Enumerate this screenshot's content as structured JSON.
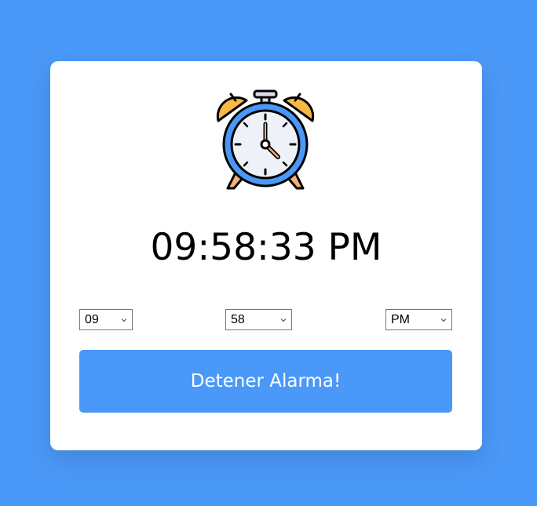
{
  "clock": {
    "display_time": "09:58:33 PM",
    "icon": "alarm-clock-icon"
  },
  "selectors": {
    "hour": "09",
    "minute": "58",
    "ampm": "PM"
  },
  "action_button": {
    "label": "Detener Alarma!"
  },
  "colors": {
    "background": "#4a98f7",
    "card": "#ffffff",
    "button": "#4a98f7"
  }
}
